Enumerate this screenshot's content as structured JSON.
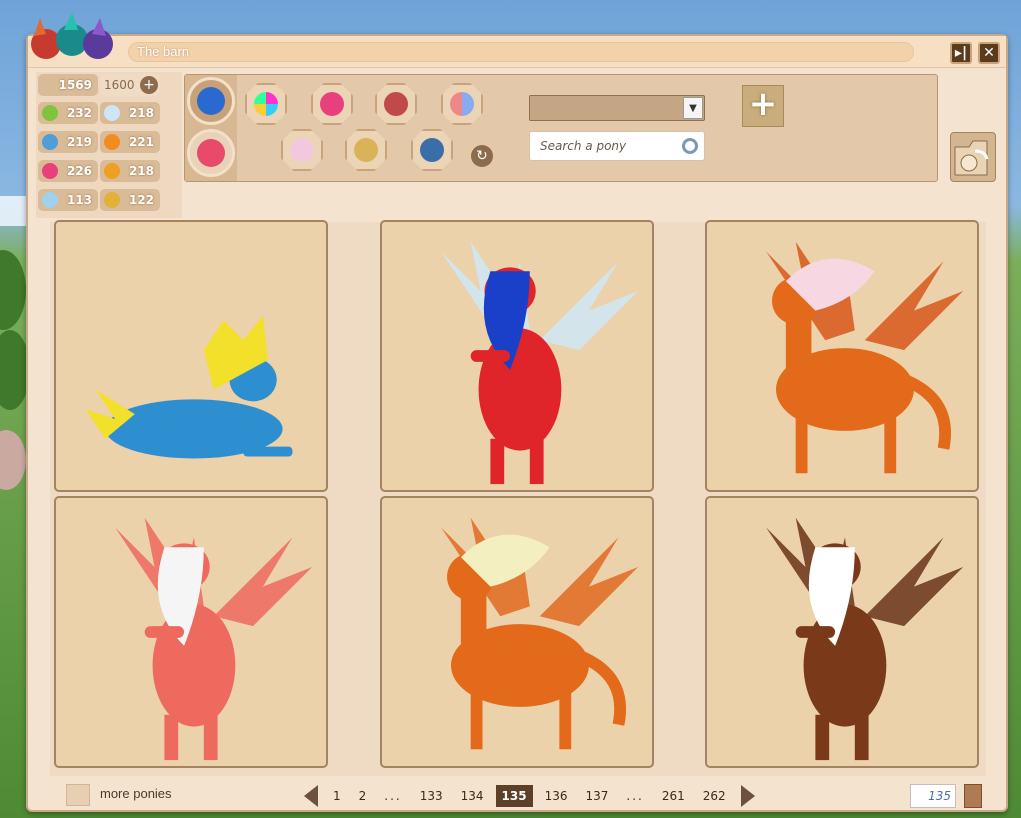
{
  "window": {
    "title": "The barn",
    "buttons": {
      "restore_icon": "restore-icon",
      "close_icon": "close-icon",
      "restore_label": "▸|",
      "close_label": "✕"
    }
  },
  "stats": {
    "value_a": "1569",
    "value_b": "1600",
    "rows": [
      {
        "icon": "apple-icon",
        "value": "232",
        "color": "#7fc43c"
      },
      {
        "icon": "cloud-icon",
        "value": "218",
        "color": "#cde6f7"
      },
      {
        "icon": "footprints-icon",
        "value": "219",
        "color": "#4f9ed8"
      },
      {
        "icon": "flame-icon",
        "value": "221",
        "color": "#f28c1f"
      },
      {
        "icon": "heart-icon",
        "value": "226",
        "color": "#e8407c"
      },
      {
        "icon": "paw-icon",
        "value": "218",
        "color": "#f0a020"
      },
      {
        "icon": "feather-icon",
        "value": "113",
        "color": "#9fd0ee"
      },
      {
        "icon": "horseshoe-icon",
        "value": "122",
        "color": "#e2b13a"
      }
    ]
  },
  "filters": {
    "select_value": "",
    "search_placeholder": "Search a pony"
  },
  "pagination": {
    "pages": [
      "1",
      "2",
      "...",
      "133",
      "134",
      "135",
      "136",
      "137",
      "...",
      "261",
      "262"
    ],
    "current": "135",
    "page_input_value": "135"
  },
  "footer": {
    "more_label": "more ponies"
  },
  "ponies": [
    {
      "body": "#2e8fd0",
      "mane": "#f2e02a",
      "wings": "",
      "pose": "lying"
    },
    {
      "body": "#e0252a",
      "mane": "#1a3fc8",
      "wings": "#cfe8f5",
      "pose": "rearing"
    },
    {
      "body": "#e26a1a",
      "mane": "#f7d8e2",
      "wings": "#d8581a",
      "pose": "standing"
    },
    {
      "body": "#ee6a5e",
      "mane": "#f5f5f5",
      "wings": "#ee6a5e",
      "pose": "rearing"
    },
    {
      "body": "#e26a1a",
      "mane": "#f4efc0",
      "wings": "#e06a20",
      "pose": "standing"
    },
    {
      "body": "#7a3a1a",
      "mane": "#ffffff",
      "wings": "#6a3418",
      "pose": "rearing"
    }
  ]
}
